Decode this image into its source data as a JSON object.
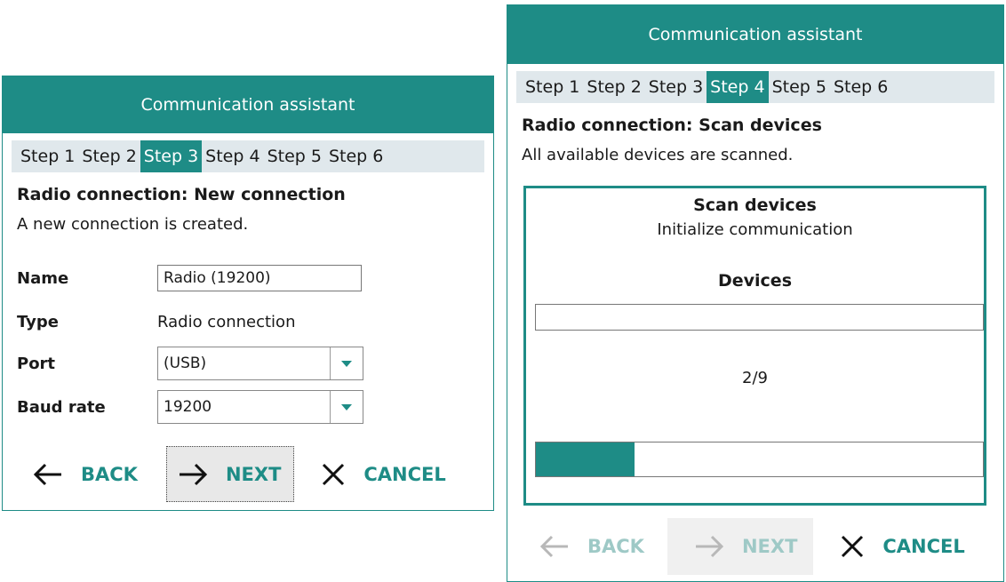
{
  "colors": {
    "accent": "#1e8c86",
    "step_bar": "#e0e8ec",
    "disabled": "#9ec9c6"
  },
  "dialog_left": {
    "title": "Communication assistant",
    "steps": [
      "Step 1",
      "Step 2",
      "Step 3",
      "Step 4",
      "Step 5",
      "Step 6"
    ],
    "active_step": 2,
    "heading": "Radio connection: New connection",
    "description": "A new connection is created.",
    "fields": {
      "name_label": "Name",
      "name_value": "Radio (19200)",
      "type_label": "Type",
      "type_value": "Radio connection",
      "port_label": "Port",
      "port_value": "(USB)",
      "baud_label": "Baud rate",
      "baud_value": "19200"
    },
    "buttons": {
      "back": "BACK",
      "next": "NEXT",
      "cancel": "CANCEL"
    },
    "icons": {
      "back": "arrow-left-icon",
      "next": "arrow-right-icon",
      "cancel": "close-icon",
      "dropdown": "chevron-down-icon"
    }
  },
  "dialog_right": {
    "title": "Communication assistant",
    "steps": [
      "Step 1",
      "Step 2",
      "Step 3",
      "Step 4",
      "Step 5",
      "Step 6"
    ],
    "active_step": 3,
    "heading": "Radio connection: Scan devices",
    "description": "All available devices are scanned.",
    "scan": {
      "title": "Scan devices",
      "status": "Initialize communication",
      "devices_label": "Devices",
      "devices_progress": 0,
      "count": "2/9",
      "overall_progress": 0.22
    },
    "buttons": {
      "back": "BACK",
      "next": "NEXT",
      "cancel": "CANCEL"
    },
    "icons": {
      "back": "arrow-left-icon",
      "next": "arrow-right-icon",
      "cancel": "close-icon"
    }
  }
}
